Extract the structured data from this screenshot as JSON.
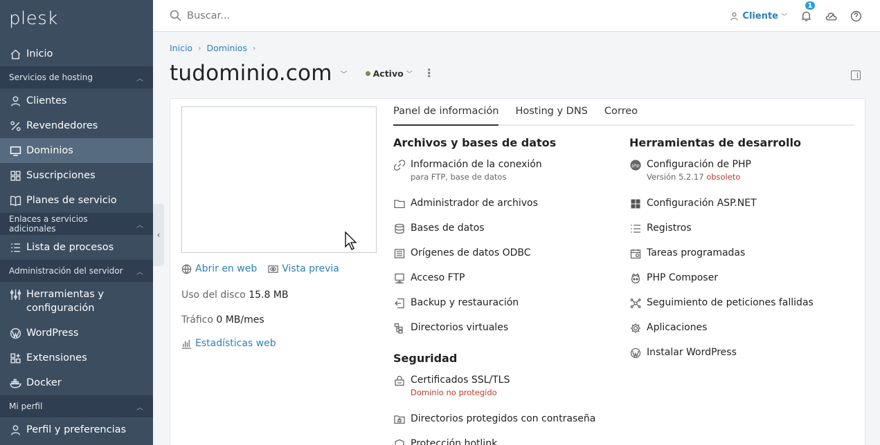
{
  "sidebar": {
    "logo": "plesk",
    "items": [
      {
        "type": "item",
        "label": "Inicio",
        "icon": "home-icon"
      },
      {
        "type": "section",
        "label": "Servicios de hosting"
      },
      {
        "type": "item",
        "label": "Clientes",
        "icon": "user-icon"
      },
      {
        "type": "item",
        "label": "Revendedores",
        "icon": "percent-icon"
      },
      {
        "type": "item",
        "label": "Dominios",
        "icon": "monitor-icon",
        "active": true
      },
      {
        "type": "item",
        "label": "Suscripciones",
        "icon": "grid-icon"
      },
      {
        "type": "item",
        "label": "Planes de servicio",
        "icon": "book-icon"
      },
      {
        "type": "section",
        "label": "Enlaces a servicios adicionales"
      },
      {
        "type": "item",
        "label": "Lista de procesos",
        "icon": "checklist-icon"
      },
      {
        "type": "section",
        "label": "Administración del servidor"
      },
      {
        "type": "item",
        "label": "Herramientas y configuración",
        "icon": "sliders-icon",
        "tall": true
      },
      {
        "type": "item",
        "label": "WordPress",
        "icon": "wordpress-icon"
      },
      {
        "type": "item",
        "label": "Extensiones",
        "icon": "extensions-icon"
      },
      {
        "type": "item",
        "label": "Docker",
        "icon": "docker-icon"
      },
      {
        "type": "section",
        "label": "Mi perfil"
      },
      {
        "type": "item",
        "label": "Perfil y preferencias",
        "icon": "profile-icon"
      }
    ]
  },
  "topbar": {
    "search_placeholder": "Buscar...",
    "user_label": "Cliente",
    "notifications_count": "1"
  },
  "breadcrumb": {
    "items": [
      "Inicio",
      "Dominios"
    ]
  },
  "domain": {
    "name": "tudominio.com",
    "status": "Activo",
    "status_color": "#7b8e52"
  },
  "preview": {
    "open_web": "Abrir en web",
    "preview_label": "Vista previa",
    "disk_label": "Uso del disco",
    "disk_value": "15.8 MB",
    "traffic_label": "Tráfico",
    "traffic_value": "0 MB/mes",
    "stats_link": "Estadísticas web"
  },
  "tabs": [
    "Panel de información",
    "Hosting y DNS",
    "Correo"
  ],
  "files_section": {
    "title": "Archivos y bases de datos",
    "tools": [
      {
        "name": "Información de la conexión",
        "sub": "para FTP, base de datos",
        "icon": "link-icon"
      },
      {
        "name": "Administrador de archivos",
        "icon": "folder-icon"
      },
      {
        "name": "Bases de datos",
        "icon": "database-icon"
      },
      {
        "name": "Orígenes de datos ODBC",
        "icon": "odbc-icon"
      },
      {
        "name": "Acceso FTP",
        "icon": "ftp-icon"
      },
      {
        "name": "Backup y restauración",
        "icon": "backup-icon"
      },
      {
        "name": "Directorios virtuales",
        "icon": "virtual-dirs-icon"
      }
    ]
  },
  "security_section": {
    "title": "Seguridad",
    "tools": [
      {
        "name": "Certificados SSL/TLS",
        "warn": "Dominio no protegido",
        "icon": "ssl-icon"
      },
      {
        "name": "Directorios protegidos con contraseña",
        "icon": "protected-folder-icon"
      },
      {
        "name": "Protección hotlink",
        "icon": "hotlink-icon"
      }
    ]
  },
  "dev_section": {
    "title": "Herramientas de desarrollo",
    "tools": [
      {
        "name": "Configuración de PHP",
        "sub": "Versión 5.2.17",
        "warn": "obsoleto",
        "icon": "php-icon"
      },
      {
        "name": "Configuración ASP.NET",
        "icon": "windows-icon"
      },
      {
        "name": "Registros",
        "icon": "list-icon"
      },
      {
        "name": "Tareas programadas",
        "icon": "calendar-icon"
      },
      {
        "name": "PHP Composer",
        "icon": "composer-icon"
      },
      {
        "name": "Seguimiento de peticiones fallidas",
        "icon": "network-icon"
      },
      {
        "name": "Aplicaciones",
        "icon": "gear-icon"
      },
      {
        "name": "Instalar WordPress",
        "icon": "wordpress-icon"
      }
    ]
  }
}
